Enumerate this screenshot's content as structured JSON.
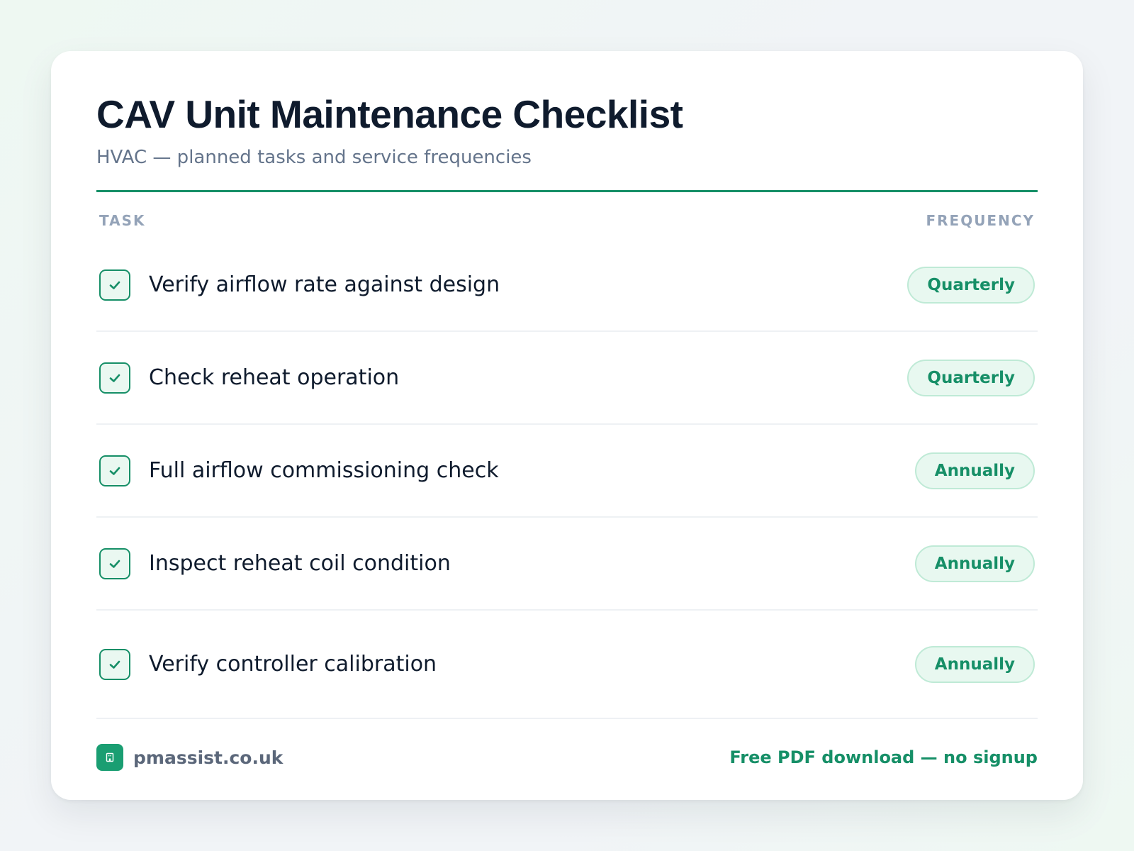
{
  "card": {
    "title": "CAV Unit Maintenance Checklist",
    "subtitle": "HVAC — planned tasks and service frequencies"
  },
  "columns": {
    "task": "TASK",
    "frequency": "FREQUENCY"
  },
  "tasks": [
    {
      "label": "Verify airflow rate against design",
      "frequency": "Quarterly",
      "checked": true
    },
    {
      "label": "Check reheat operation",
      "frequency": "Quarterly",
      "checked": true
    },
    {
      "label": "Full airflow commissioning check",
      "frequency": "Annually",
      "checked": true
    },
    {
      "label": "Inspect reheat coil condition",
      "frequency": "Annually",
      "checked": true
    },
    {
      "label": "Verify controller calibration",
      "frequency": "Annually",
      "checked": true
    }
  ],
  "footer": {
    "site": "pmassist.co.uk",
    "cta": "Free PDF download — no signup",
    "logo_icon": "building-icon"
  },
  "colors": {
    "accent": "#168f67",
    "pill_bg": "#e8f8f0",
    "title": "#0f1b2d",
    "muted": "#64748b"
  }
}
